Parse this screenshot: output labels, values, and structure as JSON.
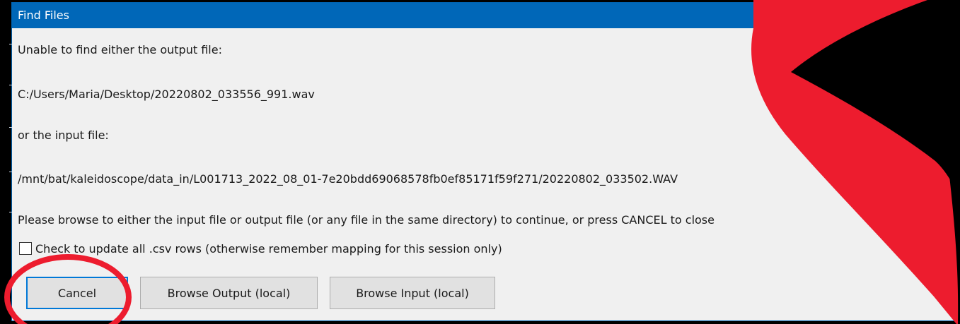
{
  "dialog": {
    "title": "Find Files",
    "line1": "Unable to find either the output file:",
    "output_path": "C:/Users/Maria/Desktop/20220802_033556_991.wav",
    "line3": "or the input file:",
    "input_path": "/mnt/bat/kaleidoscope/data_in/L001713_2022_08_01-7e20bdd69068578fb0ef85171f59f271/20220802_033502.WAV",
    "instruction": "Please browse to either the input file or output file (or any file in the same directory) to continue, or press CANCEL to close",
    "checkbox_label": "Check to update all .csv rows (otherwise remember mapping for this session only)",
    "buttons": {
      "cancel": "Cancel",
      "browse_output": "Browse Output (local)",
      "browse_input": "Browse Input (local)"
    }
  },
  "colors": {
    "titlebar": "#0067b8",
    "annotation_red": "#ed1c2e"
  }
}
